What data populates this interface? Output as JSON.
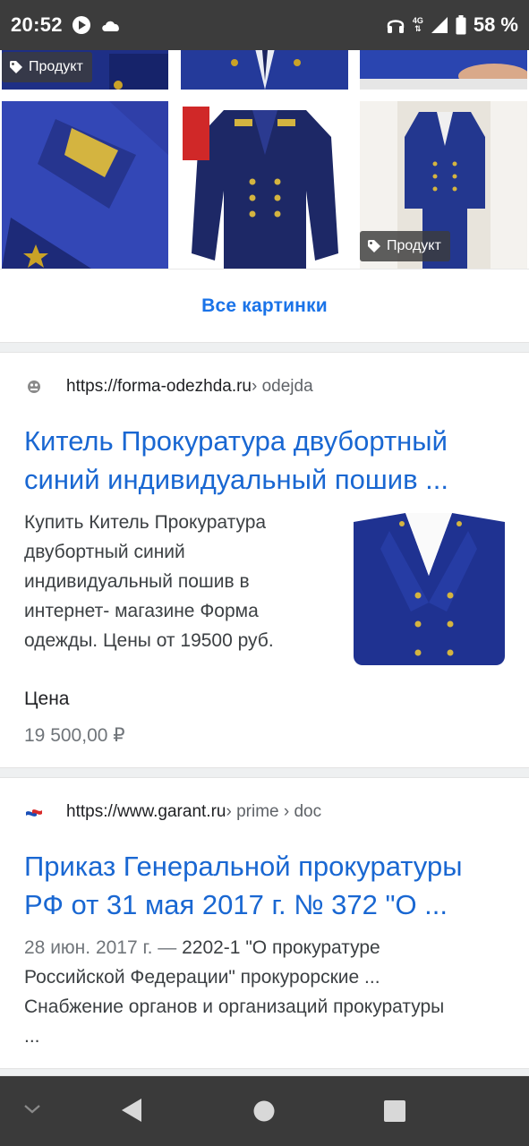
{
  "status_bar": {
    "time": "20:52",
    "network": "4G",
    "battery": "58 %",
    "icons": [
      "play-icon",
      "cloud-icon",
      "headphones-icon",
      "signal-icon",
      "battery-icon"
    ]
  },
  "image_grid": {
    "chips": [
      {
        "label": "Продукт",
        "icon": "tag-icon"
      },
      {
        "label": "Продукт",
        "icon": "tag-icon"
      }
    ]
  },
  "all_images_label": "Все картинки",
  "results": [
    {
      "site_url": "https://forma-odezhda.ru",
      "site_path": " › odejda",
      "title": "Китель Прокуратура двубортный синий индивидуальный пошив ...",
      "snippet": "Купить Китель Прокуратура двубортный синий индивидуальный пошив в интернет- магазине Форма одежды. Цены от 19500 руб.",
      "price_label": "Цена",
      "price_value": "19 500,00 ₽"
    },
    {
      "site_url": "https://www.garant.ru",
      "site_path": " › prime › doc",
      "title": "Приказ Генеральной прокуратуры РФ от 31 мая 2017 г. № 372 \"О ...",
      "date": "28 июн. 2017 г. — ",
      "snippet": "2202-1 \"О прокуратуре Российской Федерации\" прокурорские ... Снабжение органов и организаций прокуратуры ..."
    }
  ],
  "nav_bar": {
    "buttons": [
      "chevron-down-icon",
      "back-icon",
      "home-icon",
      "recents-icon"
    ]
  },
  "colors": {
    "link": "#1967d2",
    "accent": "#1a73e8",
    "uniform_blue": "#1f2a7a",
    "status_bar": "#3c3c3c"
  }
}
